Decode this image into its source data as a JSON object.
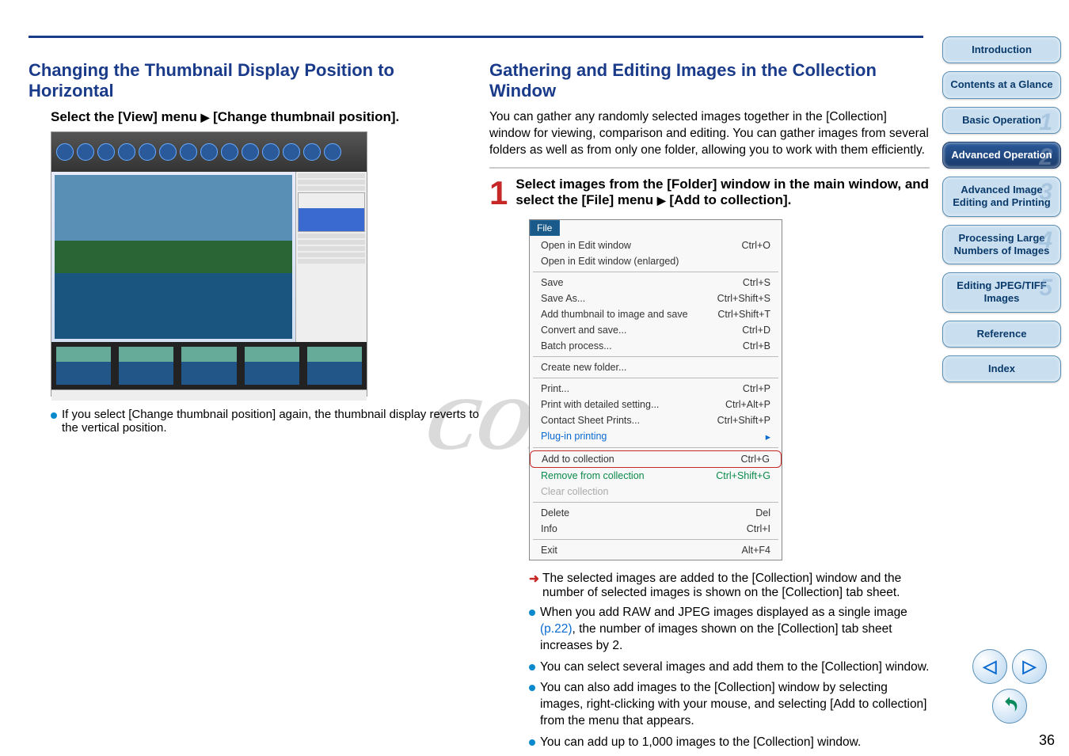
{
  "leftHeading": "Changing the Thumbnail Display Position to Horizontal",
  "leftInstruction_a": "Select the [View] menu ",
  "leftInstruction_b": " [Change thumbnail position].",
  "leftNote": "If you select [Change thumbnail position] again, the thumbnail display reverts to the vertical position.",
  "rightHeading": "Gathering and Editing Images in the Collection Window",
  "rightIntro": "You can gather any randomly selected images together in the [Collection] window for viewing, comparison and editing. You can gather images from several folders as well as from only one folder, allowing you to work with them efficiently.",
  "stepNum": "1",
  "step1_a": "Select images from the [Folder] window in the main window, and select the [File] menu ",
  "step1_b": " [Add to collection].",
  "fileTab": "File",
  "menu": {
    "openEdit": {
      "l": "Open in Edit window",
      "s": "Ctrl+O"
    },
    "openEnlarged": {
      "l": "Open in Edit window (enlarged)",
      "s": ""
    },
    "save": {
      "l": "Save",
      "s": "Ctrl+S"
    },
    "saveAs": {
      "l": "Save As...",
      "s": "Ctrl+Shift+S"
    },
    "addThumb": {
      "l": "Add thumbnail to image and save",
      "s": "Ctrl+Shift+T"
    },
    "convert": {
      "l": "Convert and save...",
      "s": "Ctrl+D"
    },
    "batch": {
      "l": "Batch process...",
      "s": "Ctrl+B"
    },
    "newFolder": {
      "l": "Create new folder...",
      "s": ""
    },
    "print": {
      "l": "Print...",
      "s": "Ctrl+P"
    },
    "printDetailed": {
      "l": "Print with detailed setting...",
      "s": "Ctrl+Alt+P"
    },
    "contactSheet": {
      "l": "Contact Sheet Prints...",
      "s": "Ctrl+Shift+P"
    },
    "plugin": {
      "l": "Plug-in printing",
      "s": "▸"
    },
    "addCollection": {
      "l": "Add to collection",
      "s": "Ctrl+G"
    },
    "removeCollection": {
      "l": "Remove from collection",
      "s": "Ctrl+Shift+G"
    },
    "clear": {
      "l": "Clear collection",
      "s": ""
    },
    "delete": {
      "l": "Delete",
      "s": "Del"
    },
    "info": {
      "l": "Info",
      "s": "Ctrl+I"
    },
    "exit": {
      "l": "Exit",
      "s": "Alt+F4"
    }
  },
  "resultText": "The selected images are added to the [Collection] window and the number of selected images is shown on the [Collection] tab sheet.",
  "bullet1_a": "When you add RAW and JPEG images displayed as a single image ",
  "bullet1_link": "(p.22)",
  "bullet1_b": ", the number of images shown on the [Collection] tab sheet increases by 2.",
  "bullet2": "You can select several images and add them to the [Collection] window.",
  "bullet3": "You can also add images to the [Collection] window by selecting images, right-clicking with your mouse, and selecting [Add to collection] from the menu that appears.",
  "bullet4": "You can add up to 1,000 images to the [Collection] window.",
  "sidebar": {
    "intro": "Introduction",
    "contents": "Contents at a Glance",
    "basic": "Basic Operation",
    "advop": "Advanced Operation",
    "advedit": "Advanced Image Editing and Printing",
    "largenum": "Processing Large Numbers of Images",
    "editjpeg": "Editing JPEG/TIFF Images",
    "reference": "Reference",
    "index": "Index"
  },
  "watermark": "COPY",
  "pageNum": "36"
}
